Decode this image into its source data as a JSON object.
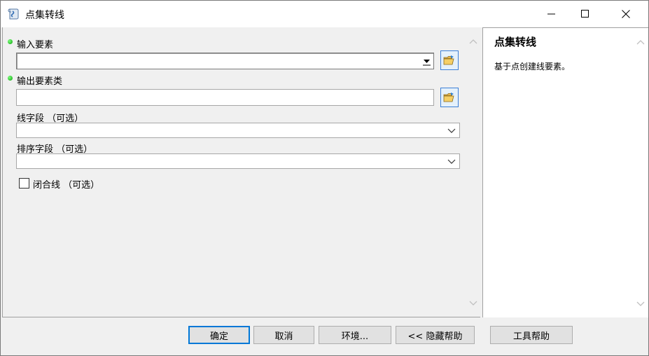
{
  "window": {
    "title": "点集转线",
    "controls": {
      "minimize": "minimize",
      "maximize": "maximize",
      "close": "close"
    }
  },
  "form": {
    "input_features_label": "输入要素",
    "output_fc_label": "输出要素类",
    "line_field_label": "线字段 （可选）",
    "sort_field_label": "排序字段 （可选）",
    "close_line_label": "闭合线 （可选）",
    "close_line_checked": false
  },
  "help": {
    "title": "点集转线",
    "description": "基于点创建线要素。"
  },
  "buttons": {
    "ok": "确定",
    "cancel": "取消",
    "environments": "环境...",
    "hide_help": "<< 隐藏帮助",
    "tool_help": "工具帮助"
  },
  "icons": {
    "app": "script-icon",
    "browse": "folder-open-icon"
  },
  "colors": {
    "accent": "#0078d7",
    "required_dot": "#0aa00a"
  }
}
